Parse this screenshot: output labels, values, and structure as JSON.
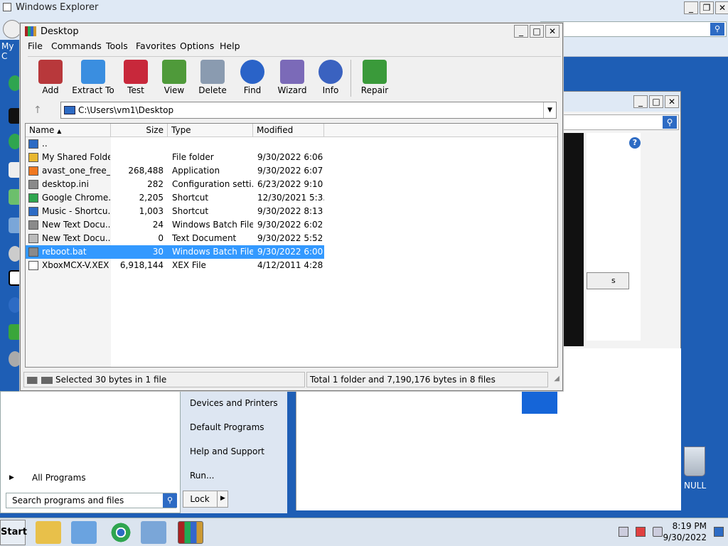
{
  "bg_explorer": {
    "title": "Windows Explorer",
    "left_label": "My C"
  },
  "rar": {
    "title": "Desktop",
    "menu": [
      "File",
      "Commands",
      "Tools",
      "Favorites",
      "Options",
      "Help"
    ],
    "toolbar": [
      {
        "label": "Add",
        "icon": "add-archive-icon",
        "color": "#b8383b"
      },
      {
        "label": "Extract To",
        "icon": "extract-folder-icon",
        "color": "#3a8ee0"
      },
      {
        "label": "Test",
        "icon": "test-icon",
        "color": "#c8283b"
      },
      {
        "label": "View",
        "icon": "view-book-icon",
        "color": "#4f9a3a"
      },
      {
        "label": "Delete",
        "icon": "delete-bin-icon",
        "color": "#8a9bb0"
      },
      {
        "label": "Find",
        "icon": "find-magnifier-icon",
        "color": "#2a63c8"
      },
      {
        "label": "Wizard",
        "icon": "wizard-wand-icon",
        "color": "#7b6ab8"
      },
      {
        "label": "Info",
        "icon": "info-icon",
        "color": "#3a62c0"
      },
      {
        "label": "Repair",
        "icon": "repair-icon",
        "color": "#3a9a3a"
      }
    ],
    "path": "C:\\Users\\vm1\\Desktop",
    "columns": [
      "Name",
      "Size",
      "Type",
      "Modified"
    ],
    "rows": [
      {
        "name": "..",
        "size": "",
        "type": "",
        "modified": "",
        "icon_color": "#2d6bc4"
      },
      {
        "name": "My Shared Folder",
        "size": "",
        "type": "File folder",
        "modified": "9/30/2022 6:06 ...",
        "icon_color": "#e8b730"
      },
      {
        "name": "avast_one_free_...",
        "size": "268,488",
        "type": "Application",
        "modified": "9/30/2022 6:07 ...",
        "icon_color": "#f07820"
      },
      {
        "name": "desktop.ini",
        "size": "282",
        "type": "Configuration setti...",
        "modified": "6/23/2022 9:10 ...",
        "icon_color": "#8a8a8a"
      },
      {
        "name": "Google Chrome....",
        "size": "2,205",
        "type": "Shortcut",
        "modified": "12/30/2021 5:3...",
        "icon_color": "#2fa54f"
      },
      {
        "name": "Music - Shortcu...",
        "size": "1,003",
        "type": "Shortcut",
        "modified": "9/30/2022 8:13 ...",
        "icon_color": "#2d6bc4"
      },
      {
        "name": "New Text Docu...",
        "size": "24",
        "type": "Windows Batch File",
        "modified": "9/30/2022 6:02 ...",
        "icon_color": "#8a8a8a"
      },
      {
        "name": "New Text Docu...",
        "size": "0",
        "type": "Text Document",
        "modified": "9/30/2022 5:52 ...",
        "icon_color": "#bbbbbb"
      },
      {
        "name": "reboot.bat",
        "size": "30",
        "type": "Windows Batch File",
        "modified": "9/30/2022 6:00 ...",
        "icon_color": "#8a8a8a",
        "selected": true
      },
      {
        "name": "XboxMCX-V.XEX",
        "size": "6,918,144",
        "type": "XEX File",
        "modified": "4/12/2011 4:28 ...",
        "icon_color": "#ffffff"
      }
    ],
    "status_left": "Selected 30 bytes in 1 file",
    "status_right": "Total 1 folder and 7,190,176 bytes in 8 files"
  },
  "start_menu": {
    "right_items": [
      "Devices and Printers",
      "Default Programs",
      "Help and Support",
      "Run..."
    ],
    "all_programs": "All Programs",
    "search_placeholder": "Search programs and files",
    "lock": "Lock"
  },
  "win2": {
    "button_text": "s"
  },
  "desktop": {
    "recycle_label": "NULL"
  },
  "taskbar": {
    "start": "Start",
    "time": "8:19 PM",
    "date": "9/30/2022"
  }
}
